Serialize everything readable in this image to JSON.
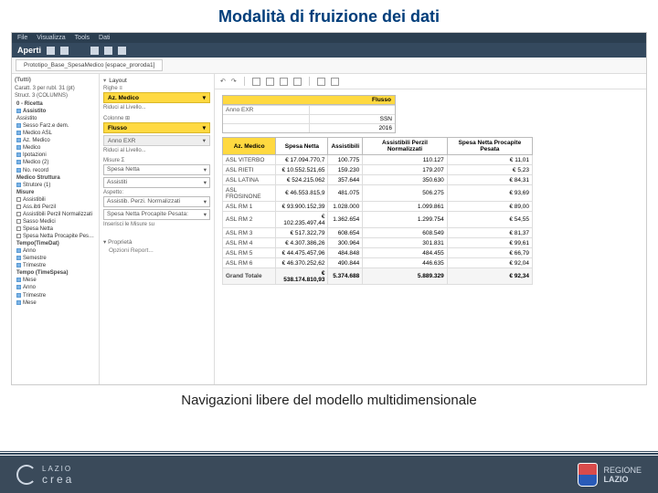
{
  "slide": {
    "title": "Modalità di fruizione dei dati",
    "caption": "Navigazioni libere del modello multidimensionale"
  },
  "menubar": {
    "items": [
      "File",
      "Visualizza",
      "Tools",
      "Dati"
    ]
  },
  "titlebar": {
    "label": "Aperti"
  },
  "tab": {
    "name": "Prototipo_Base_SpesaMedico [espace_proroda1]"
  },
  "nav": {
    "head": "(Tutti)",
    "sub1": "Caratt. 3 per rubl. 31 (pt)",
    "sub2": "Struct. 3 (COLUMNS)",
    "items": [
      {
        "t": "0 - Ricetta",
        "b": true
      },
      {
        "t": "Assistito",
        "b": true,
        "sq": "blue"
      },
      {
        "t": "Assistito",
        "b": false
      },
      {
        "t": "Sesso Farz.e dem.",
        "b": false,
        "sq": "blue"
      },
      {
        "t": "Medico ASL",
        "b": false,
        "sq": "blue"
      },
      {
        "t": "Az. Medico",
        "b": false,
        "sq": "blue"
      },
      {
        "t": "Medico",
        "b": false,
        "sq": "blue"
      },
      {
        "t": "Ipotazioni",
        "b": false,
        "sq": "blue"
      },
      {
        "t": "Medico (2)",
        "b": false,
        "sq": "blue"
      },
      {
        "t": "No. record",
        "b": false,
        "sq": "blue"
      },
      {
        "t": "Medico Struttura",
        "b": true
      },
      {
        "t": "Strutore (1)",
        "b": false,
        "sq": "blue"
      },
      {
        "t": "Misure",
        "b": true
      },
      {
        "t": "Assistibili",
        "b": false,
        "sq": "off"
      },
      {
        "t": "Ass.ibti Perzil",
        "b": false,
        "sq": "off"
      },
      {
        "t": "Assistibili Perzil Normalizzati",
        "b": false,
        "sq": "off"
      },
      {
        "t": "Sasso Medici",
        "b": false,
        "sq": "off"
      },
      {
        "t": "Spesa Netta",
        "b": false,
        "sq": "off"
      },
      {
        "t": "Spesa Netta Procapite Pesata",
        "b": false,
        "sq": "off"
      },
      {
        "t": "Tempo(TimeDat)",
        "b": true
      },
      {
        "t": "Anno",
        "b": false,
        "sq": "blue"
      },
      {
        "t": "Semestre",
        "b": false,
        "sq": "blue"
      },
      {
        "t": "Trimestre",
        "b": false,
        "sq": "blue"
      },
      {
        "t": "Tempo (TimeSpesa)",
        "b": true
      },
      {
        "t": "Mese",
        "b": false,
        "sq": "blue"
      },
      {
        "t": "Anno",
        "b": false,
        "sq": "blue"
      },
      {
        "t": "Trimestre",
        "b": false,
        "sq": "blue"
      },
      {
        "t": "Mese",
        "b": false,
        "sq": "blue"
      }
    ]
  },
  "design": {
    "layout": "Layout",
    "righe": "Righe",
    "pill_az": "Az. Medico",
    "riduci1": "Riduci al Livello...",
    "colonne": "Colonne",
    "pill_flusso": "Flusso",
    "pill_anno": "Anno EXR",
    "riduci2": "Riduci al Livello...",
    "misure": "Misure",
    "sel_spesa": "Spesa Netta",
    "sel_assist": "Assistiti",
    "lbl_aspetto": "Aspetto:",
    "sel_aspetto": "Assistib. Perzi. Normalizzati",
    "sel_spesaproc": "Spesa Netta Procapite Pesata:",
    "link_misure": "Inserisci le Misure su",
    "proprieta": "Proprietà",
    "opzioni": "Opzioni Report..."
  },
  "filter": {
    "head": "Flusso",
    "rows": [
      {
        "k": "Anno EXR",
        "v": ""
      },
      {
        "k": "",
        "v": "SSN"
      },
      {
        "k": "",
        "v": "2016"
      }
    ]
  },
  "table": {
    "headers": [
      "Az. Medico",
      "Spesa Netta",
      "Assistibili",
      "Assistibili Perzil Normalizzati",
      "Spesa Netta Procapite Pesata"
    ],
    "rows": [
      {
        "h": "ASL VITERBO",
        "c": [
          "€ 17.094.770,7",
          "100.775",
          "110.127",
          "€ 11,01"
        ]
      },
      {
        "h": "ASL RIETI",
        "c": [
          "€ 10.552.521,65",
          "159.230",
          "179.207",
          "€ 5,23"
        ]
      },
      {
        "h": "ASL LATINA",
        "c": [
          "€ 524.215.062",
          "357.644",
          "350.630",
          "€ 84,31"
        ]
      },
      {
        "h": "ASL FROSINONE",
        "c": [
          "€ 46.553.815,9",
          "481.075",
          "506.275",
          "€ 93,69"
        ]
      },
      {
        "h": "ASL RM 1",
        "c": [
          "€ 93.900.152,39",
          "1.028.000",
          "1.099.861",
          "€ 89,00"
        ]
      },
      {
        "h": "ASL RM 2",
        "c": [
          "€ 102.235.497,44",
          "1.362.654",
          "1.299.754",
          "€ 54,55"
        ]
      },
      {
        "h": "ASL RM 3",
        "c": [
          "€ 517.322,79",
          "608.654",
          "608.549",
          "€ 81,37"
        ]
      },
      {
        "h": "ASL RM 4",
        "c": [
          "€ 4.307.386,26",
          "300.964",
          "301.831",
          "€ 99,61"
        ]
      },
      {
        "h": "ASL RM 5",
        "c": [
          "€ 44.475.457,96",
          "484.848",
          "484.455",
          "€ 66,79"
        ]
      },
      {
        "h": "ASL RM 6",
        "c": [
          "€ 46.370.252,62",
          "490.844",
          "446.635",
          "€ 92,04"
        ]
      }
    ],
    "total": {
      "h": "Grand Totale",
      "c": [
        "€ 538.174.810,93",
        "5.374.688",
        "5.889.329",
        "€ 92,34"
      ]
    }
  },
  "footer": {
    "left1": "LAZIO",
    "left2": "crea",
    "right1": "REGIONE",
    "right2": "LAZIO"
  }
}
